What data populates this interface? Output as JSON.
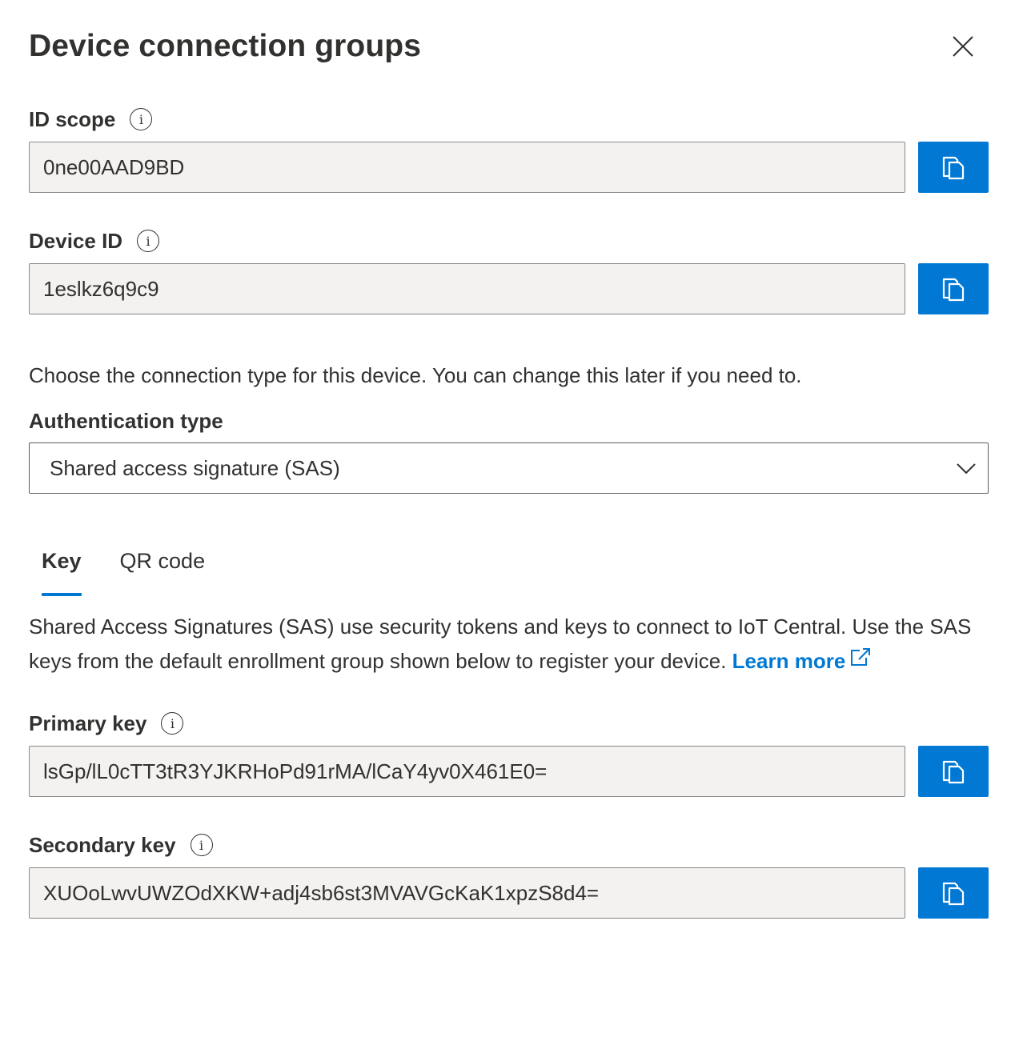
{
  "panel": {
    "title": "Device connection groups"
  },
  "id_scope": {
    "label": "ID scope",
    "value": "0ne00AAD9BD"
  },
  "device_id": {
    "label": "Device ID",
    "value": "1eslkz6q9c9"
  },
  "connection": {
    "helper_text": "Choose the connection type for this device. You can change this later if you need to.",
    "auth_label": "Authentication type",
    "auth_selected": "Shared access signature (SAS)"
  },
  "tabs": [
    {
      "label": "Key",
      "active": true
    },
    {
      "label": "QR code",
      "active": false
    }
  ],
  "description": {
    "text": "Shared Access Signatures (SAS) use security tokens and keys to connect to IoT Central. Use the SAS keys from the default enrollment group shown below to register your device. ",
    "link_label": "Learn more"
  },
  "primary_key": {
    "label": "Primary key",
    "value": "lsGp/lL0cTT3tR3YJKRHoPd91rMA/lCaY4yv0X461E0="
  },
  "secondary_key": {
    "label": "Secondary key",
    "value": "XUOoLwvUWZOdXKW+adj4sb6st3MVAVGcKaK1xpzS8d4="
  },
  "icons": {
    "close": "close-icon",
    "info": "info-icon",
    "copy": "copy-icon",
    "chevron": "chevron-down-icon",
    "external": "external-link-icon"
  },
  "colors": {
    "accent": "#0078d4",
    "text": "#323130",
    "readonly_bg": "#f3f2f1"
  }
}
